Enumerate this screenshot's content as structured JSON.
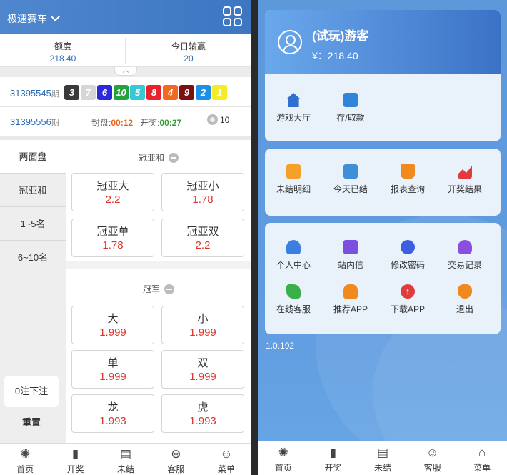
{
  "left": {
    "header": {
      "game_name": "极速赛车"
    },
    "info": {
      "quota_label": "额度",
      "quota_value": "218.40",
      "profit_label": "今日输赢",
      "profit_value": "20"
    },
    "prev_draw": {
      "issue": "31395545",
      "suffix": "期",
      "balls": [
        {
          "n": "3",
          "color": "#3a3a3a"
        },
        {
          "n": "7",
          "color": "#d6d6d6"
        },
        {
          "n": "6",
          "color": "#2a2ad8"
        },
        {
          "n": "10",
          "color": "#24a33a"
        },
        {
          "n": "5",
          "color": "#36c8d6"
        },
        {
          "n": "8",
          "color": "#e8212a"
        },
        {
          "n": "4",
          "color": "#f26a22"
        },
        {
          "n": "9",
          "color": "#7a1010"
        },
        {
          "n": "2",
          "color": "#1d8fe6"
        },
        {
          "n": "1",
          "color": "#f5ec28"
        }
      ]
    },
    "current": {
      "issue": "31395556",
      "suffix": "期",
      "close_label": "封盘:",
      "close_time": "00:12",
      "open_label": "开奖:",
      "open_time": "00:27",
      "count": "10"
    },
    "side_menu": [
      "两面盘",
      "冠亚和",
      "1~5名",
      "6~10名"
    ],
    "bet_count": "0注下注",
    "reset": "重置",
    "section1": {
      "title": "冠亚和",
      "cells": [
        {
          "name": "冠亚大",
          "odds": "2.2"
        },
        {
          "name": "冠亚小",
          "odds": "1.78"
        },
        {
          "name": "冠亚单",
          "odds": "1.78"
        },
        {
          "name": "冠亚双",
          "odds": "2.2"
        }
      ]
    },
    "section2": {
      "title": "冠军",
      "cells": [
        {
          "name": "大",
          "odds": "1.999"
        },
        {
          "name": "小",
          "odds": "1.999"
        },
        {
          "name": "单",
          "odds": "1.999"
        },
        {
          "name": "双",
          "odds": "1.999"
        },
        {
          "name": "龙",
          "odds": "1.993"
        },
        {
          "name": "虎",
          "odds": "1.993"
        }
      ]
    },
    "nav": [
      {
        "label": "首页",
        "icon": "home-icon"
      },
      {
        "label": "开奖",
        "icon": "chart-icon"
      },
      {
        "label": "未结",
        "icon": "document-icon"
      },
      {
        "label": "客服",
        "icon": "service-icon"
      },
      {
        "label": "菜单",
        "icon": "menu-icon"
      }
    ]
  },
  "right": {
    "user": {
      "name": "(试玩)游客",
      "balance": "¥：218.40"
    },
    "top_items": [
      {
        "label": "游戏大厅",
        "icon": "house-icon",
        "color": "#2f6fd0"
      },
      {
        "label": "存/取款",
        "icon": "wallet-icon",
        "color": "#2f86d8"
      }
    ],
    "mid_items": [
      {
        "label": "未结明细",
        "icon": "list-icon",
        "color": "#f4a12a"
      },
      {
        "label": "今天已结",
        "icon": "settled-icon",
        "color": "#3d8fd8"
      },
      {
        "label": "报表查询",
        "icon": "book-icon",
        "color": "#f08a1e"
      },
      {
        "label": "开奖结果",
        "icon": "trend-icon",
        "color": "#e23b3b"
      }
    ],
    "bottom_items": [
      {
        "label": "个人中心",
        "icon": "person-icon",
        "color": "#3b7fe0"
      },
      {
        "label": "站内信",
        "icon": "message-icon",
        "color": "#7b4fe0"
      },
      {
        "label": "修改密码",
        "icon": "lock-icon",
        "color": "#3b5fe0"
      },
      {
        "label": "交易记录",
        "icon": "record-icon",
        "color": "#8b4fe0"
      },
      {
        "label": "在线客服",
        "icon": "chat-icon",
        "color": "#3bb04a"
      },
      {
        "label": "推荐APP",
        "icon": "thumbs-up-icon",
        "color": "#f08a1e"
      },
      {
        "label": "下载APP",
        "icon": "download-icon",
        "color": "#e23b3b"
      },
      {
        "label": "退出",
        "icon": "exit-icon",
        "color": "#f08a1e"
      }
    ],
    "version": "1.0.192",
    "nav": [
      {
        "label": "首页",
        "icon": "home-icon"
      },
      {
        "label": "开奖",
        "icon": "chart-icon"
      },
      {
        "label": "未结",
        "icon": "document-icon"
      },
      {
        "label": "客服",
        "icon": "service-icon"
      },
      {
        "label": "菜单",
        "icon": "menu-icon"
      }
    ]
  }
}
